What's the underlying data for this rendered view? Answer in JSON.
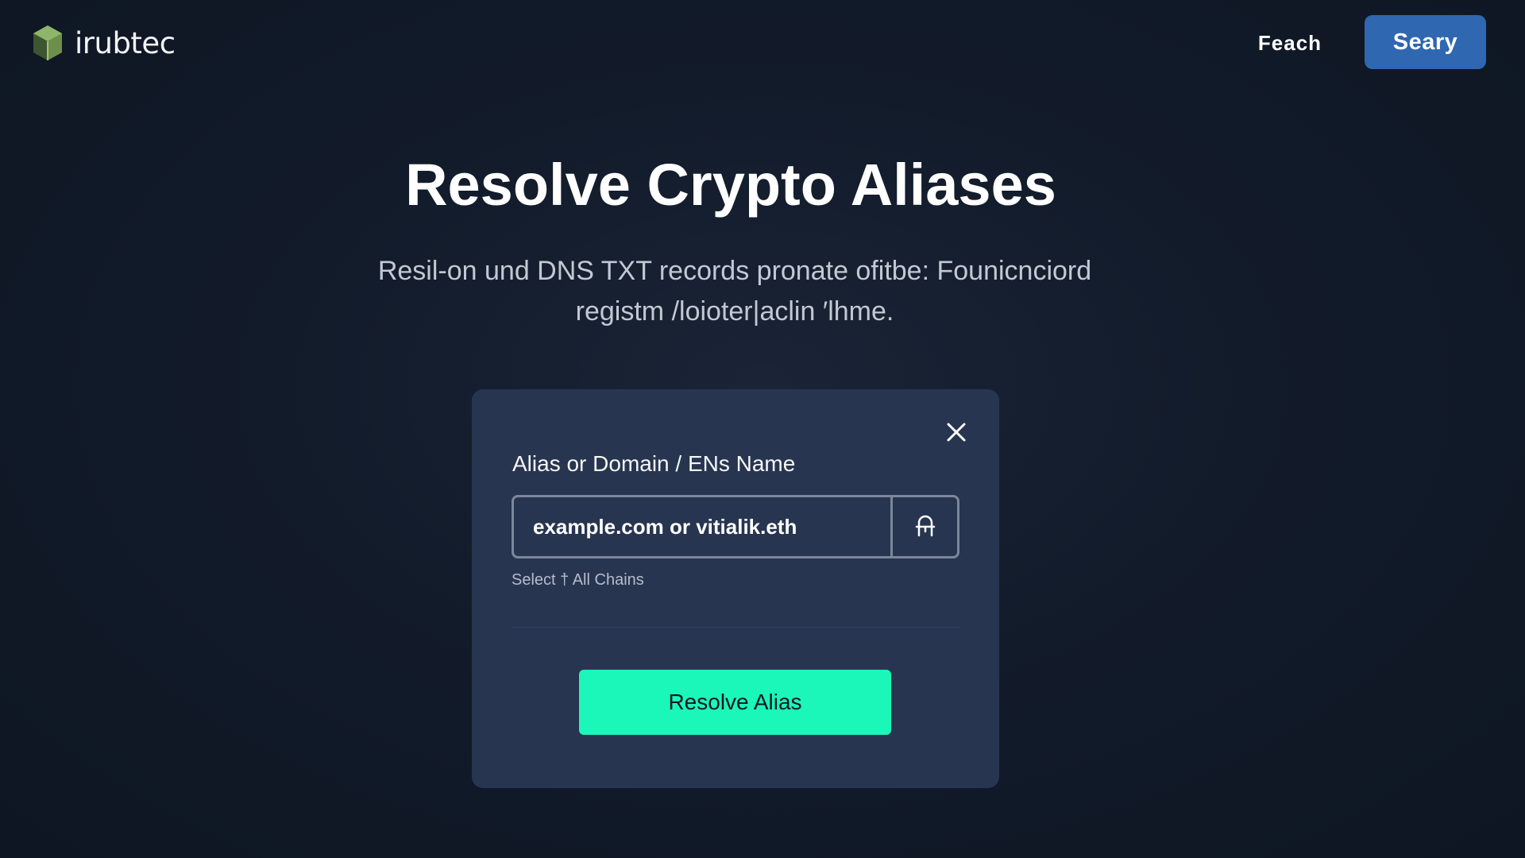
{
  "brand": {
    "name": "irubtec",
    "logo_icon": "hexagon-cube-icon"
  },
  "nav": {
    "link_label": "Feach",
    "button_label": "Seary",
    "button_color": "#2f67b0"
  },
  "hero": {
    "title": "Resolve Crypto Aliases",
    "subtitle_line1": "Resil-on und DNS  TXT records pronate ofitbe: Founicnciord",
    "subtitle_line2": "registm /loioter|aclin ′lhme."
  },
  "card": {
    "close_icon": "close-icon",
    "field_label": "Alias or Domain / ENs Name",
    "input_placeholder": "example.com or vitialik.eth",
    "input_value": "",
    "lock_icon": "lock-icon",
    "chain_select": "Select † All Chains",
    "resolve_label": "Resolve Alias",
    "resolve_color": "#1bf7b8"
  }
}
